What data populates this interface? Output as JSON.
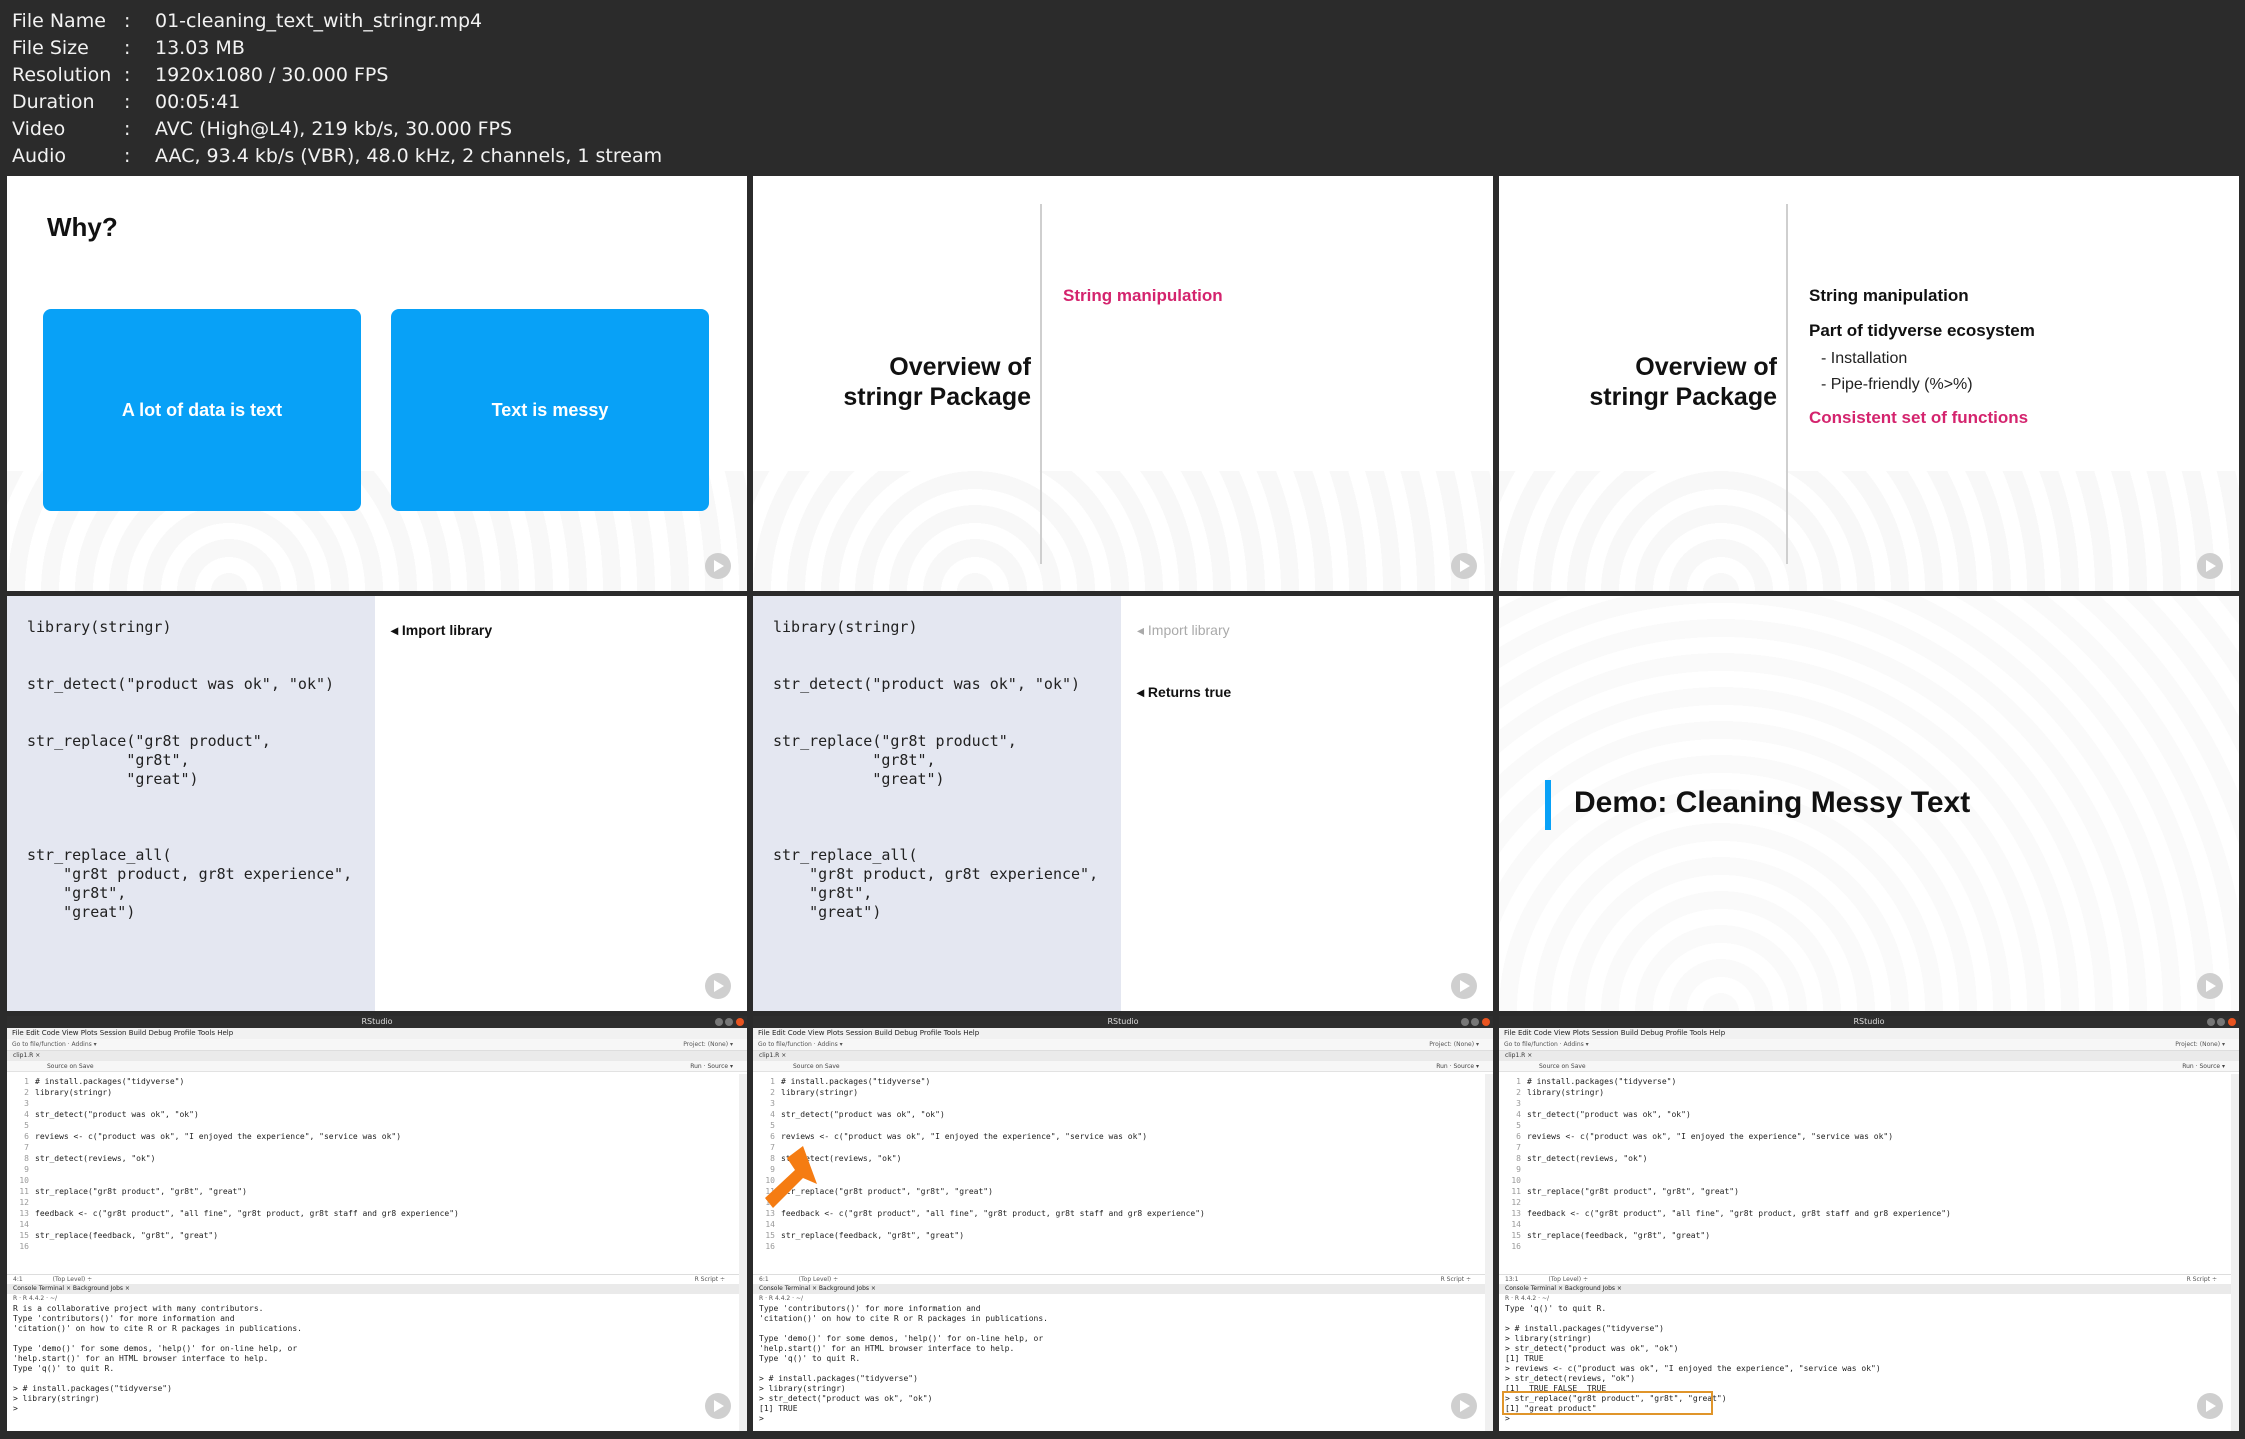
{
  "meta": [
    {
      "k": "File Name",
      "v": "01-cleaning_text_with_stringr.mp4"
    },
    {
      "k": "File Size",
      "v": "13.03 MB"
    },
    {
      "k": "Resolution",
      "v": "1920x1080 / 30.000 FPS"
    },
    {
      "k": "Duration",
      "v": "00:05:41"
    },
    {
      "k": "Video",
      "v": "AVC (High@L4), 219 kb/s, 30.000 FPS"
    },
    {
      "k": "Audio",
      "v": "AAC, 93.4 kb/s (VBR), 48.0 kHz, 2 channels, 1 stream"
    }
  ],
  "sep": ":",
  "why": {
    "title": "Why?",
    "box1": "A lot of data is text",
    "box2": "Text is messy"
  },
  "overview": {
    "line1": "Overview of",
    "line2": "stringr Package",
    "item1": "String manipulation",
    "item2": "Part of tidyverse ecosystem",
    "sub1": "-  Installation",
    "sub2": "-  Pipe-friendly (%>%)",
    "item3": "Consistent set of functions"
  },
  "code_slide": {
    "code": "library(stringr)\n\n\nstr_detect(\"product was ok\", \"ok\")\n\n\nstr_replace(\"gr8t product\",\n           \"gr8t\",\n           \"great\")\n\n\n\nstr_replace_all(\n    \"gr8t product, gr8t experience\",\n    \"gr8t\",\n    \"great\")",
    "note1": "◂ Import library",
    "note2": "◂ Returns true"
  },
  "demo": {
    "title": "Demo: Cleaning Messy Text"
  },
  "rstudio": {
    "title": "RStudio",
    "menu": "File  Edit  Code  View  Plots  Session  Build  Debug  Profile  Tools  Help",
    "toolbar": "Go to file/function    ·   Addins ▾",
    "project": "Project: (None) ▾",
    "tab": "clip1.R ×",
    "etool": "Source on Save",
    "run": "Run   ·   Source ▾",
    "status_a": "4:1",
    "status_b": "6:1",
    "status_c": "13:1",
    "status_mid": "(Top Level) ÷",
    "status_right": "R Script ÷",
    "ctabs": "Console    Terminal ×    Background Jobs ×",
    "cpath": "R · R 4.4.2 · ~/",
    "lines": [
      {
        "n": "1",
        "t": "# install.packages(\"tidyverse\")",
        "k": "cm"
      },
      {
        "n": "2",
        "t": "library(stringr)",
        "k": ""
      },
      {
        "n": "3",
        "t": "",
        "k": ""
      },
      {
        "n": "4",
        "t": "str_detect(\"product was ok\", \"ok\")",
        "k": ""
      },
      {
        "n": "5",
        "t": "",
        "k": ""
      },
      {
        "n": "6",
        "t": "reviews <- c(\"product was ok\", \"I enjoyed the experience\", \"service was ok\")",
        "k": ""
      },
      {
        "n": "7",
        "t": "",
        "k": ""
      },
      {
        "n": "8",
        "t": "str_detect(reviews, \"ok\")",
        "k": ""
      },
      {
        "n": "9",
        "t": "",
        "k": ""
      },
      {
        "n": "10",
        "t": "",
        "k": ""
      },
      {
        "n": "11",
        "t": "str_replace(\"gr8t product\", \"gr8t\", \"great\")",
        "k": ""
      },
      {
        "n": "12",
        "t": "",
        "k": ""
      },
      {
        "n": "13",
        "t": "feedback <- c(\"gr8t product\", \"all fine\", \"gr8t product, gr8t staff and gr8 experience\")",
        "k": ""
      },
      {
        "n": "14",
        "t": "",
        "k": ""
      },
      {
        "n": "15",
        "t": "str_replace(feedback, \"gr8t\", \"great\")",
        "k": ""
      },
      {
        "n": "16",
        "t": "",
        "k": ""
      }
    ],
    "console1": "R is a collaborative project with many contributors.\nType 'contributors()' for more information and\n'citation()' on how to cite R or R packages in publications.\n\nType 'demo()' for some demos, 'help()' for on-line help, or\n'help.start()' for an HTML browser interface to help.\nType 'q()' to quit R.\n\n> # install.packages(\"tidyverse\")\n> library(stringr)\n> ",
    "console2": "Type 'contributors()' for more information and\n'citation()' on how to cite R or R packages in publications.\n\nType 'demo()' for some demos, 'help()' for on-line help, or\n'help.start()' for an HTML browser interface to help.\nType 'q()' to quit R.\n\n> # install.packages(\"tidyverse\")\n> library(stringr)\n> str_detect(\"product was ok\", \"ok\")\n[1] TRUE\n> ",
    "console3": "Type 'q()' to quit R.\n\n> # install.packages(\"tidyverse\")\n> library(stringr)\n> str_detect(\"product was ok\", \"ok\")\n[1] TRUE\n> reviews <- c(\"product was ok\", \"I enjoyed the experience\", \"service was ok\")\n> str_detect(reviews, \"ok\")\n[1]  TRUE FALSE  TRUE\n> str_replace(\"gr8t product\", \"gr8t\", \"great\")\n[1] \"great product\"\n> "
  },
  "colors": {
    "accent_blue": "#08a1f7",
    "pink": "#d4246e",
    "arrow": "#f57c12",
    "highlight": "#e0952a"
  }
}
